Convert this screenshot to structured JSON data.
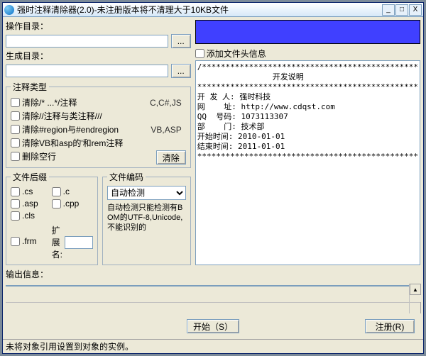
{
  "window": {
    "title": "强时注释清除器(2.0)-未注册版本将不清理大于10KB文件"
  },
  "labels": {
    "operate_dir": "操作目录：",
    "output_dir": "生成目录：",
    "browse": "...",
    "add_header": "添加文件头信息",
    "comment_types": "注释类型",
    "file_suffix": "文件后缀",
    "encoding": "文件编码",
    "ext_label": "扩展名:",
    "output_info": "输出信息：",
    "start": "开始（S）",
    "register": "注册(R)",
    "clear": "清除"
  },
  "comment_types": [
    {
      "label": "清除/* ...*/注释",
      "lang": "C,C#,JS"
    },
    {
      "label": "清除//注释与类注释///",
      "lang": ""
    },
    {
      "label": "清除#region与#endregion",
      "lang": "VB,ASP"
    },
    {
      "label": "清除VB和asp的'和rem注释",
      "lang": ""
    },
    {
      "label": "删除空行",
      "lang": ""
    }
  ],
  "suffixes": [
    {
      "label": ".cs"
    },
    {
      "label": ".c"
    },
    {
      "label": ".asp"
    },
    {
      "label": ".cpp"
    },
    {
      "label": ".cls"
    },
    {
      "label": ""
    },
    {
      "label": ".frm"
    }
  ],
  "encoding": {
    "selected": "自动检测",
    "note": "自动检测只能检测有BOM的UTF-8,Unicode,不能识别的"
  },
  "header_info": "/**********************************************\n                开发说明\n***********************************************\n开 发 人: 强时科技\n网    址: http://www.cdqst.com\nQQ  号码: 1073113307\n部    门: 技术部\n开始时间: 2010-01-01\n结束时间: 2011-01-01\n***********************************************",
  "status": "未将对象引用设置到对象的实例。"
}
